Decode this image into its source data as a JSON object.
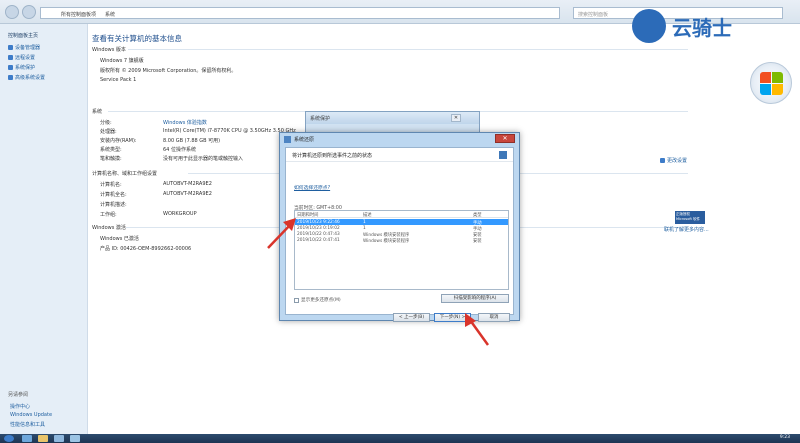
{
  "address": {
    "part1": "所有控制面板项",
    "part2": "系统",
    "search_placeholder": "搜索控制面板"
  },
  "brand": {
    "text": "云骑士"
  },
  "sidebar": {
    "title": "控制面板主页",
    "links": [
      "设备管理器",
      "远程设置",
      "系统保护",
      "高级系统设置"
    ],
    "see_also": "另请参阅",
    "bottom_links": [
      "操作中心",
      "Windows Update",
      "性能信息和工具"
    ]
  },
  "main": {
    "title": "查看有关计算机的基本信息",
    "edition_head": "Windows 版本",
    "edition_name": "Windows 7 旗舰版",
    "copyright": "版权所有 © 2009 Microsoft Corporation。保留所有权利。",
    "service_pack": "Service Pack 1",
    "system_head": "系统",
    "system_rows": [
      {
        "label": "分级:",
        "value": "Windows 体验指数"
      },
      {
        "label": "处理器:",
        "value": "Intel(R) Core(TM) i7-8770K CPU @ 3.50GHz   3.50 GHz"
      },
      {
        "label": "安装内存(RAM):",
        "value": "8.00 GB (7.88 GB 可用)"
      },
      {
        "label": "系统类型:",
        "value": "64 位操作系统"
      },
      {
        "label": "笔和触摸:",
        "value": "没有可用于此显示器的笔或触控输入"
      }
    ],
    "computer_head": "计算机名称、域和工作组设置",
    "computer_rows": [
      {
        "label": "计算机名:",
        "value": "AUTOBVT-M2RA9E2"
      },
      {
        "label": "计算机全名:",
        "value": "AUTOBVT-M2RA9E2"
      },
      {
        "label": "计算机描述:",
        "value": ""
      },
      {
        "label": "工作组:",
        "value": "WORKGROUP"
      }
    ],
    "change_settings": "更改设置",
    "activation_head": "Windows 激活",
    "activation_status": "Windows 已激活",
    "product_id": "产品 ID: 00426-OEM-8992662-00006",
    "genuine_badge": "正版授权 Microsoft 软件",
    "genuine_more": "联机了解更多内容..."
  },
  "bg_dialog": {
    "title": "系统保护",
    "close": "✕"
  },
  "dialog": {
    "title": "系统还原",
    "close": "✕",
    "header": "将计算机还原到所选事件之前的状态",
    "link": "如何选择还原点?",
    "timezone": "当前时区: GMT+8:00",
    "columns": [
      "日期和时间",
      "描述",
      "类型"
    ],
    "rows": [
      {
        "date": "2019/10/23 9:22:46",
        "desc": "1",
        "type": "手动",
        "selected": true
      },
      {
        "date": "2019/10/23 0:19:02",
        "desc": "1",
        "type": "手动",
        "selected": false
      },
      {
        "date": "2019/10/22 0:47:43",
        "desc": "Windows 模块安装程序",
        "type": "安装",
        "selected": false
      },
      {
        "date": "2019/10/22 0:47:41",
        "desc": "Windows 模块安装程序",
        "type": "安装",
        "selected": false
      }
    ],
    "show_more": "显示更多还原点(M)",
    "scan_button": "扫描受影响的程序(A)",
    "back_button": "< 上一步(B)",
    "next_button": "下一步(N) >",
    "cancel_button": "取消"
  },
  "taskbar": {
    "clock": "9:23"
  }
}
